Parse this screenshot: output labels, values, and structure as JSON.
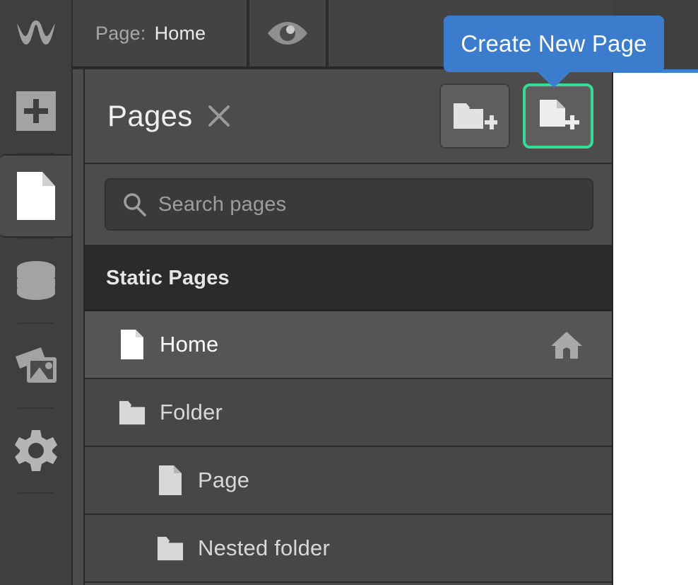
{
  "topbar": {
    "logo_icon": "webflow-logo-icon",
    "page_label": "Page:",
    "page_value": "Home",
    "preview_icon": "eye-icon"
  },
  "rail": {
    "items": [
      {
        "id": "add",
        "icon": "plus-square-icon",
        "selected": false
      },
      {
        "id": "pages",
        "icon": "page-icon",
        "selected": true
      },
      {
        "id": "cms",
        "icon": "database-icon",
        "selected": false
      },
      {
        "id": "assets",
        "icon": "image-stack-icon",
        "selected": false
      },
      {
        "id": "settings",
        "icon": "gear-icon",
        "selected": false
      }
    ]
  },
  "panel": {
    "title": "Pages",
    "close_icon": "close-icon",
    "actions": [
      {
        "id": "new-folder",
        "icon": "new-folder-icon",
        "highlighted": false
      },
      {
        "id": "new-page",
        "icon": "new-page-icon",
        "highlighted": true
      }
    ],
    "search": {
      "icon": "search-icon",
      "placeholder": "Search pages",
      "value": ""
    },
    "sections": [
      {
        "label": "Static Pages",
        "rows": [
          {
            "label": "Home",
            "icon": "page-icon",
            "indent": 0,
            "selected": true,
            "right_icon": "home-icon"
          },
          {
            "label": "Folder",
            "icon": "folder-icon",
            "indent": 0,
            "selected": false,
            "right_icon": ""
          },
          {
            "label": "Page",
            "icon": "page-icon",
            "indent": 1,
            "selected": false,
            "right_icon": ""
          },
          {
            "label": "Nested folder",
            "icon": "folder-icon",
            "indent": 1,
            "selected": false,
            "right_icon": ""
          }
        ]
      }
    ]
  },
  "tooltip": {
    "label": "Create New Page",
    "color": "#3b7dcc"
  },
  "colors": {
    "panel_bg": "#4c4c4c",
    "row_bg": "#474747",
    "row_selected_bg": "#555555",
    "section_bg": "#2b2b2b",
    "rail_bg": "#3f3f3f",
    "highlight_green": "#35dc95",
    "tooltip_blue": "#3b7dcc",
    "canvas_top_border": "#3b82d6"
  }
}
